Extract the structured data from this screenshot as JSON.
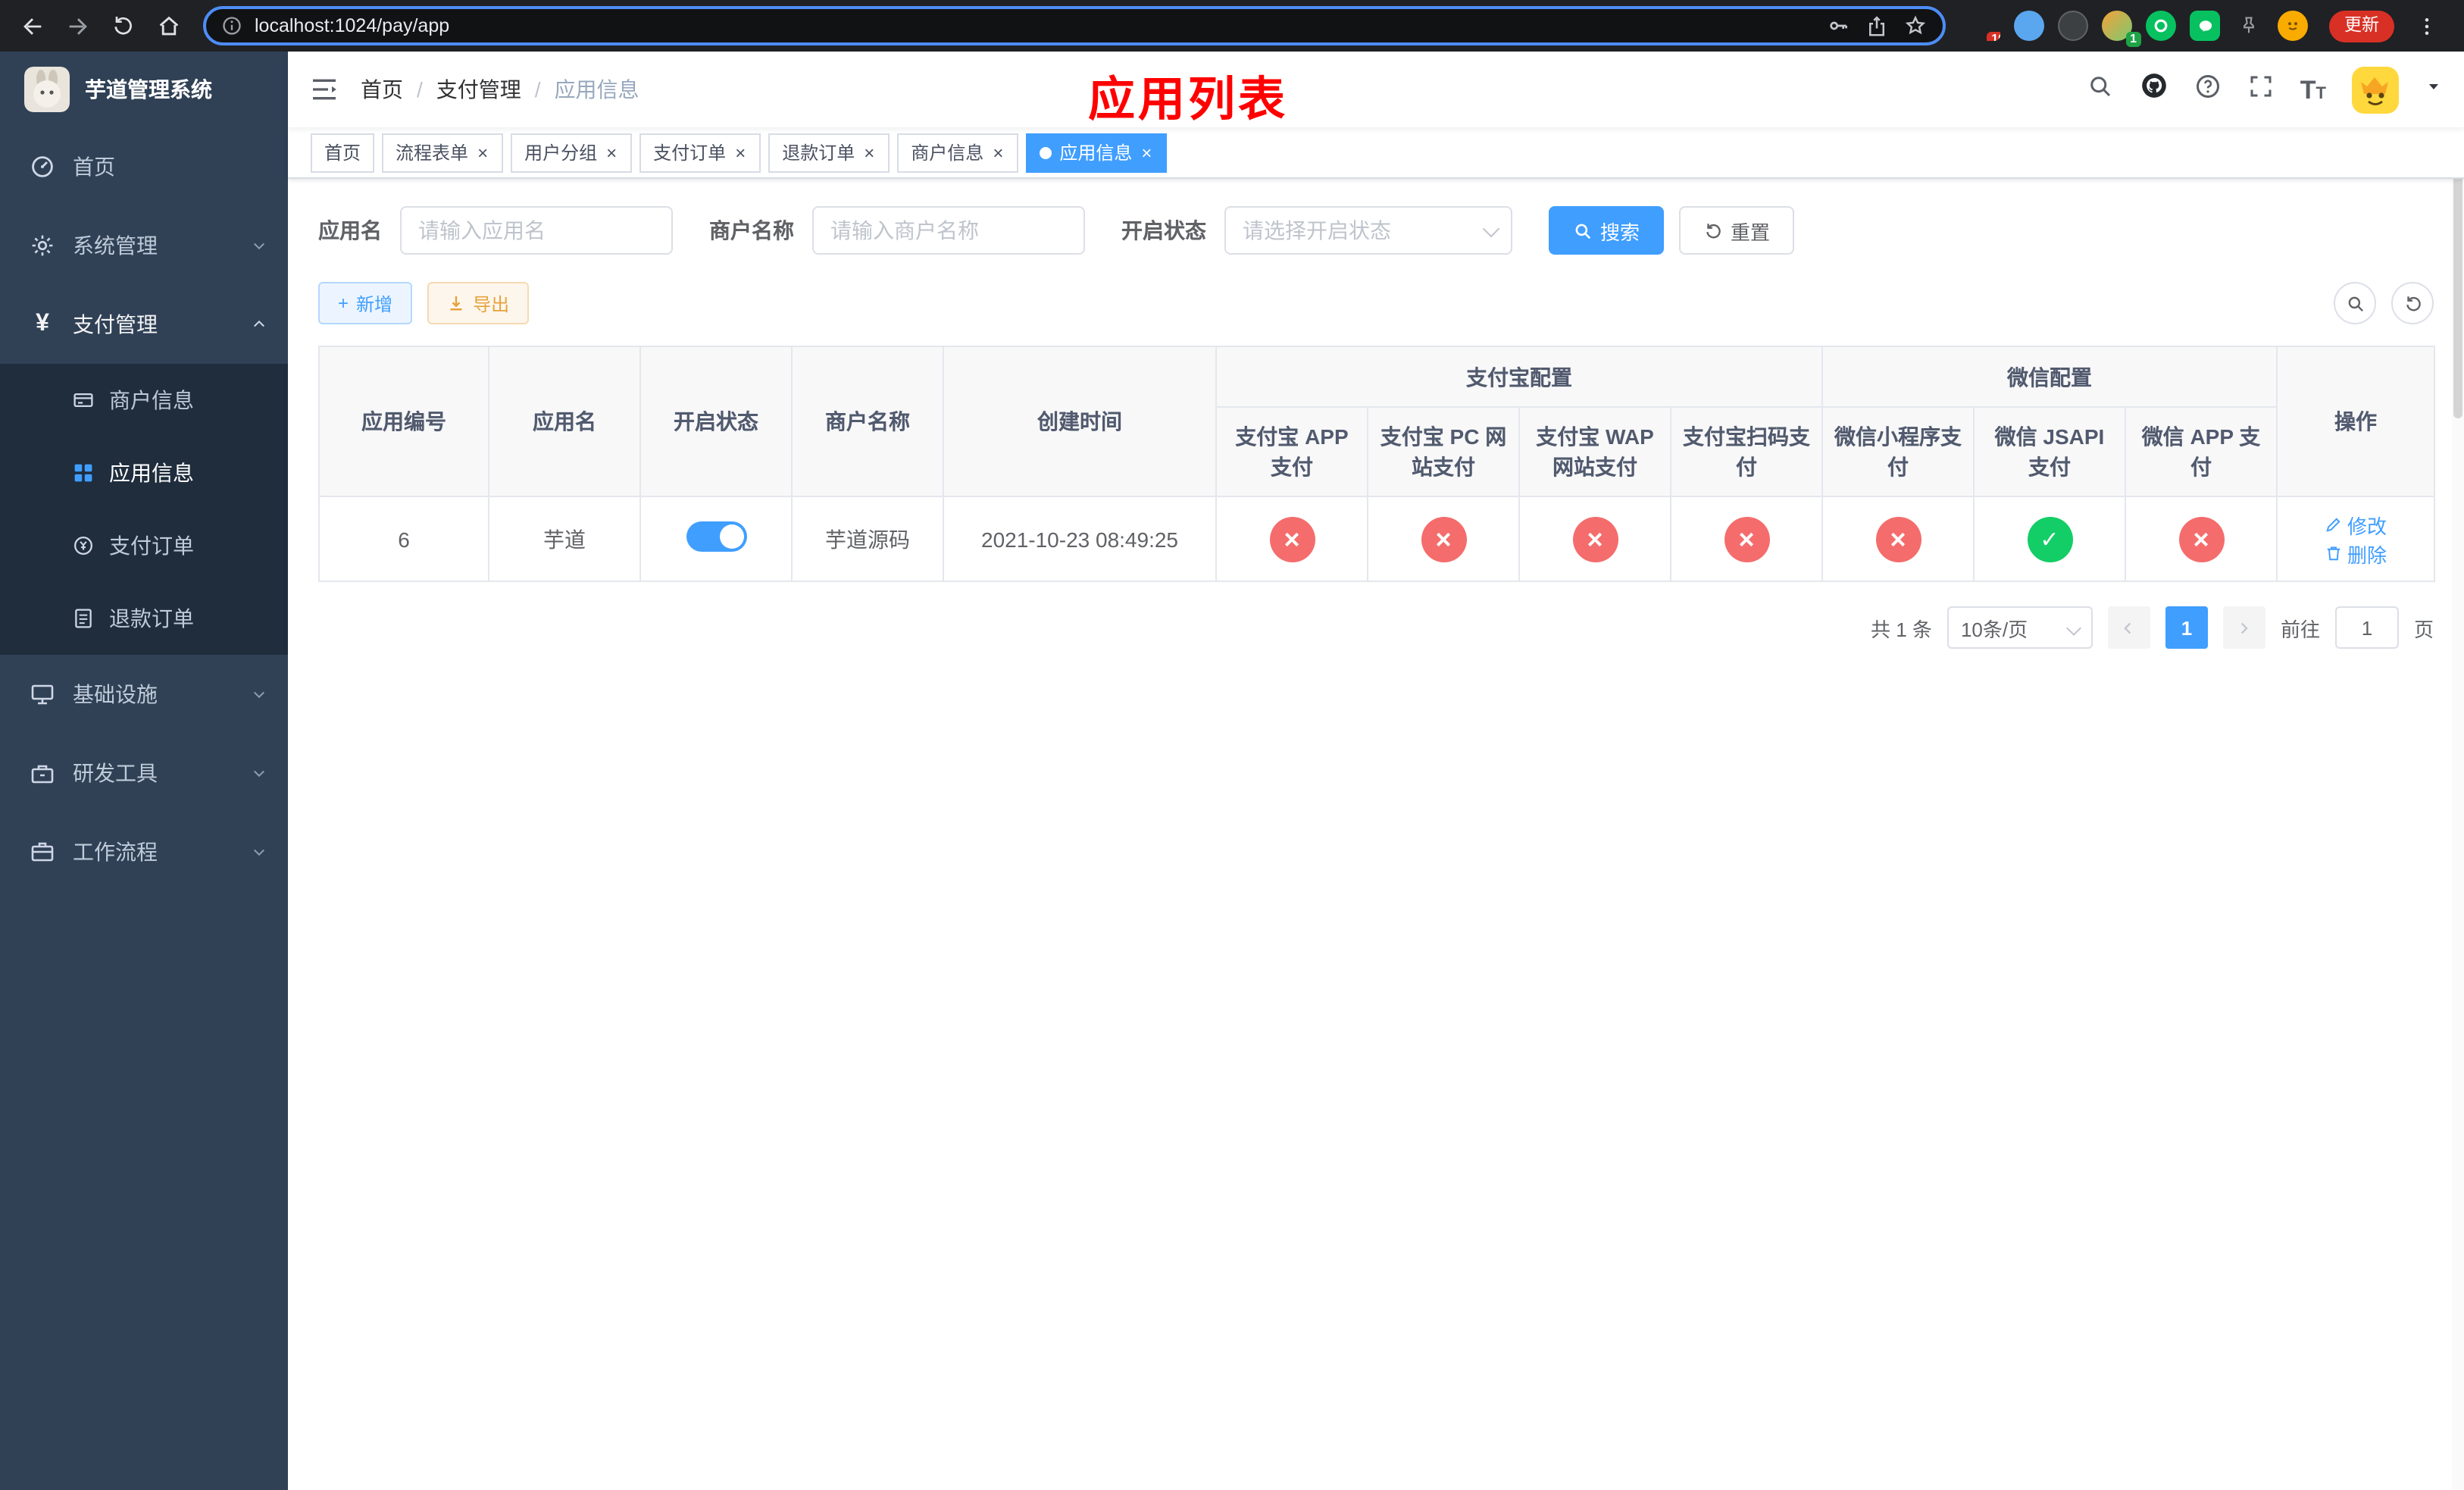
{
  "browser": {
    "url": "localhost:1024/pay/app",
    "update_label": "更新",
    "extensions_badge": "10",
    "profile_badge": "1"
  },
  "ui": {
    "breadcrumb_separator": "/"
  },
  "icons": {
    "plus": "+",
    "close": "×",
    "yen": "¥",
    "text_size": "T"
  },
  "sidebar": {
    "title": "芋道管理系统",
    "items": [
      {
        "label": "首页"
      },
      {
        "label": "系统管理"
      },
      {
        "label": "支付管理",
        "children": [
          {
            "label": "商户信息"
          },
          {
            "label": "应用信息"
          },
          {
            "label": "支付订单"
          },
          {
            "label": "退款订单"
          }
        ]
      },
      {
        "label": "基础设施"
      },
      {
        "label": "研发工具"
      },
      {
        "label": "工作流程"
      }
    ]
  },
  "header": {
    "breadcrumb": [
      "首页",
      "支付管理",
      "应用信息"
    ],
    "annotation": "应用列表"
  },
  "tabs": [
    {
      "label": "首页"
    },
    {
      "label": "流程表单"
    },
    {
      "label": "用户分组"
    },
    {
      "label": "支付订单"
    },
    {
      "label": "退款订单"
    },
    {
      "label": "商户信息"
    },
    {
      "label": "应用信息"
    }
  ],
  "filters": {
    "app_name_label": "应用名",
    "app_name_placeholder": "请输入应用名",
    "merchant_name_label": "商户名称",
    "merchant_name_placeholder": "请输入商户名称",
    "status_label": "开启状态",
    "status_placeholder": "请选择开启状态",
    "search_label": "搜索",
    "reset_label": "重置"
  },
  "toolbar": {
    "add_label": "新增",
    "export_label": "导出"
  },
  "table": {
    "headers": {
      "id": "应用编号",
      "name": "应用名",
      "status": "开启状态",
      "merchant": "商户名称",
      "created": "创建时间",
      "alipay_group": "支付宝配置",
      "wechat_group": "微信配置",
      "alipay_app": "支付宝 APP 支付",
      "alipay_pc": "支付宝 PC 网站支付",
      "alipay_wap": "支付宝 WAP 网站支付",
      "alipay_scan": "支付宝扫码支付",
      "wechat_mini": "微信小程序支付",
      "wechat_jsapi": "微信 JSAPI 支付",
      "wechat_app": "微信 APP 支付",
      "actions": "操作"
    },
    "row": {
      "id": "6",
      "name": "芋道",
      "status_state": "on",
      "merchant": "芋道源码",
      "created": "2021-10-23 08:49:25",
      "alipay_app_state": "fail",
      "alipay_pc_state": "fail",
      "alipay_wap_state": "fail",
      "alipay_scan_state": "fail",
      "wechat_mini_state": "fail",
      "wechat_jsapi_state": "success",
      "wechat_app_state": "fail",
      "edit_label": "修改",
      "delete_label": "删除"
    }
  },
  "pagination": {
    "total": "共 1 条",
    "page_size": "10条/页",
    "page": "1",
    "goto_label": "前往",
    "goto_value": "1",
    "page_unit": "页"
  }
}
